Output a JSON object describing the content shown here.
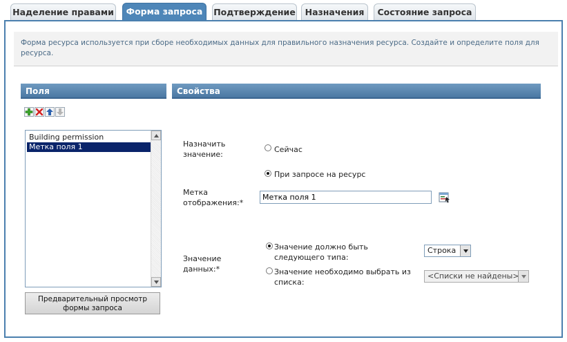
{
  "tabs": [
    {
      "label": "Наделение правами",
      "active": false
    },
    {
      "label": "Форма запроса",
      "active": true
    },
    {
      "label": "Подтверждение",
      "active": false
    },
    {
      "label": "Назначения",
      "active": false
    },
    {
      "label": "Состояние запроса",
      "active": false
    }
  ],
  "description": "Форма ресурса используется при сборе необходимых данных для правильного назначения ресурса. Создайте и определите поля для ресурса.",
  "fields_panel": {
    "title": "Поля",
    "toolbar": {
      "add": "plus-icon",
      "delete": "delete-icon",
      "move_up": "arrow-up-icon",
      "move_down": "arrow-down-icon"
    },
    "items": [
      "Building permission",
      "Метка поля 1"
    ],
    "selected_index": 1,
    "preview_button": "Предварительный просмотр формы запроса"
  },
  "properties_panel": {
    "title": "Свойства",
    "assign_value_label": "Назначить значение:",
    "assign_now": "Сейчас",
    "assign_on_request": "При запросе на ресурс",
    "display_label": "Метка отображения:*",
    "display_value": "Метка поля 1",
    "data_value_label": "Значение данных:*",
    "type_option": "Значение должно быть следующего типа:",
    "list_option": "Значение необходимо выбрать из списка:",
    "type_select": "Строка",
    "list_select": "<Списки не найдены>"
  },
  "colors": {
    "accent": "#4e86b8",
    "header": "#5b88b3",
    "selected": "#0a246a"
  }
}
